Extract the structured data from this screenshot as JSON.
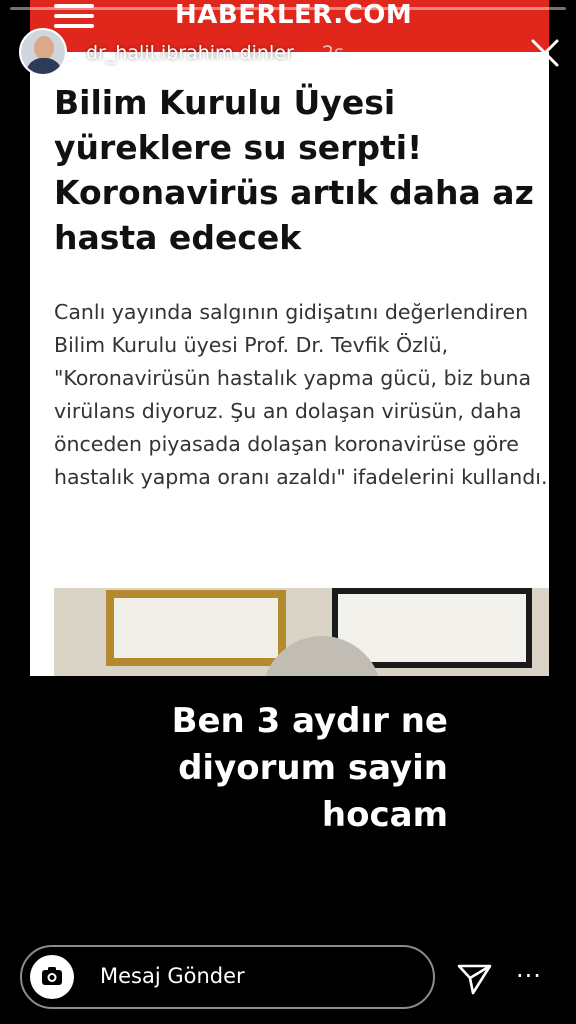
{
  "article": {
    "brand": "HABERLER.COM",
    "headline": "Bilim Kurulu Üyesi yüreklere su serpti! Koronavirüs artık daha az hasta edecek",
    "body": "Canlı yayında salgının gidişatını değerlendiren Bilim Kurulu üyesi Prof. Dr. Tevfik Özlü, \"Koronavirüsün hastalık yapma gücü, biz buna virülans diyoruz. Şu an dolaşan virüsün, daha önceden piyasada dolaşan koronavirüse göre hastalık yapma oranı azaldı\" ifadelerini kullandı."
  },
  "story": {
    "username": "dr_halil.ibrahim.dinler",
    "time": "2s",
    "caption_lines": [
      "Ben 3 aydır ne",
      "diyorum sayin",
      "hocam"
    ]
  },
  "reply": {
    "placeholder": "Mesaj Gönder",
    "more": "···"
  },
  "colors": {
    "brand_red": "#e1261c",
    "background": "#000000"
  },
  "icons": [
    "menu-icon",
    "close-icon",
    "camera-icon",
    "send-icon",
    "more-icon"
  ]
}
